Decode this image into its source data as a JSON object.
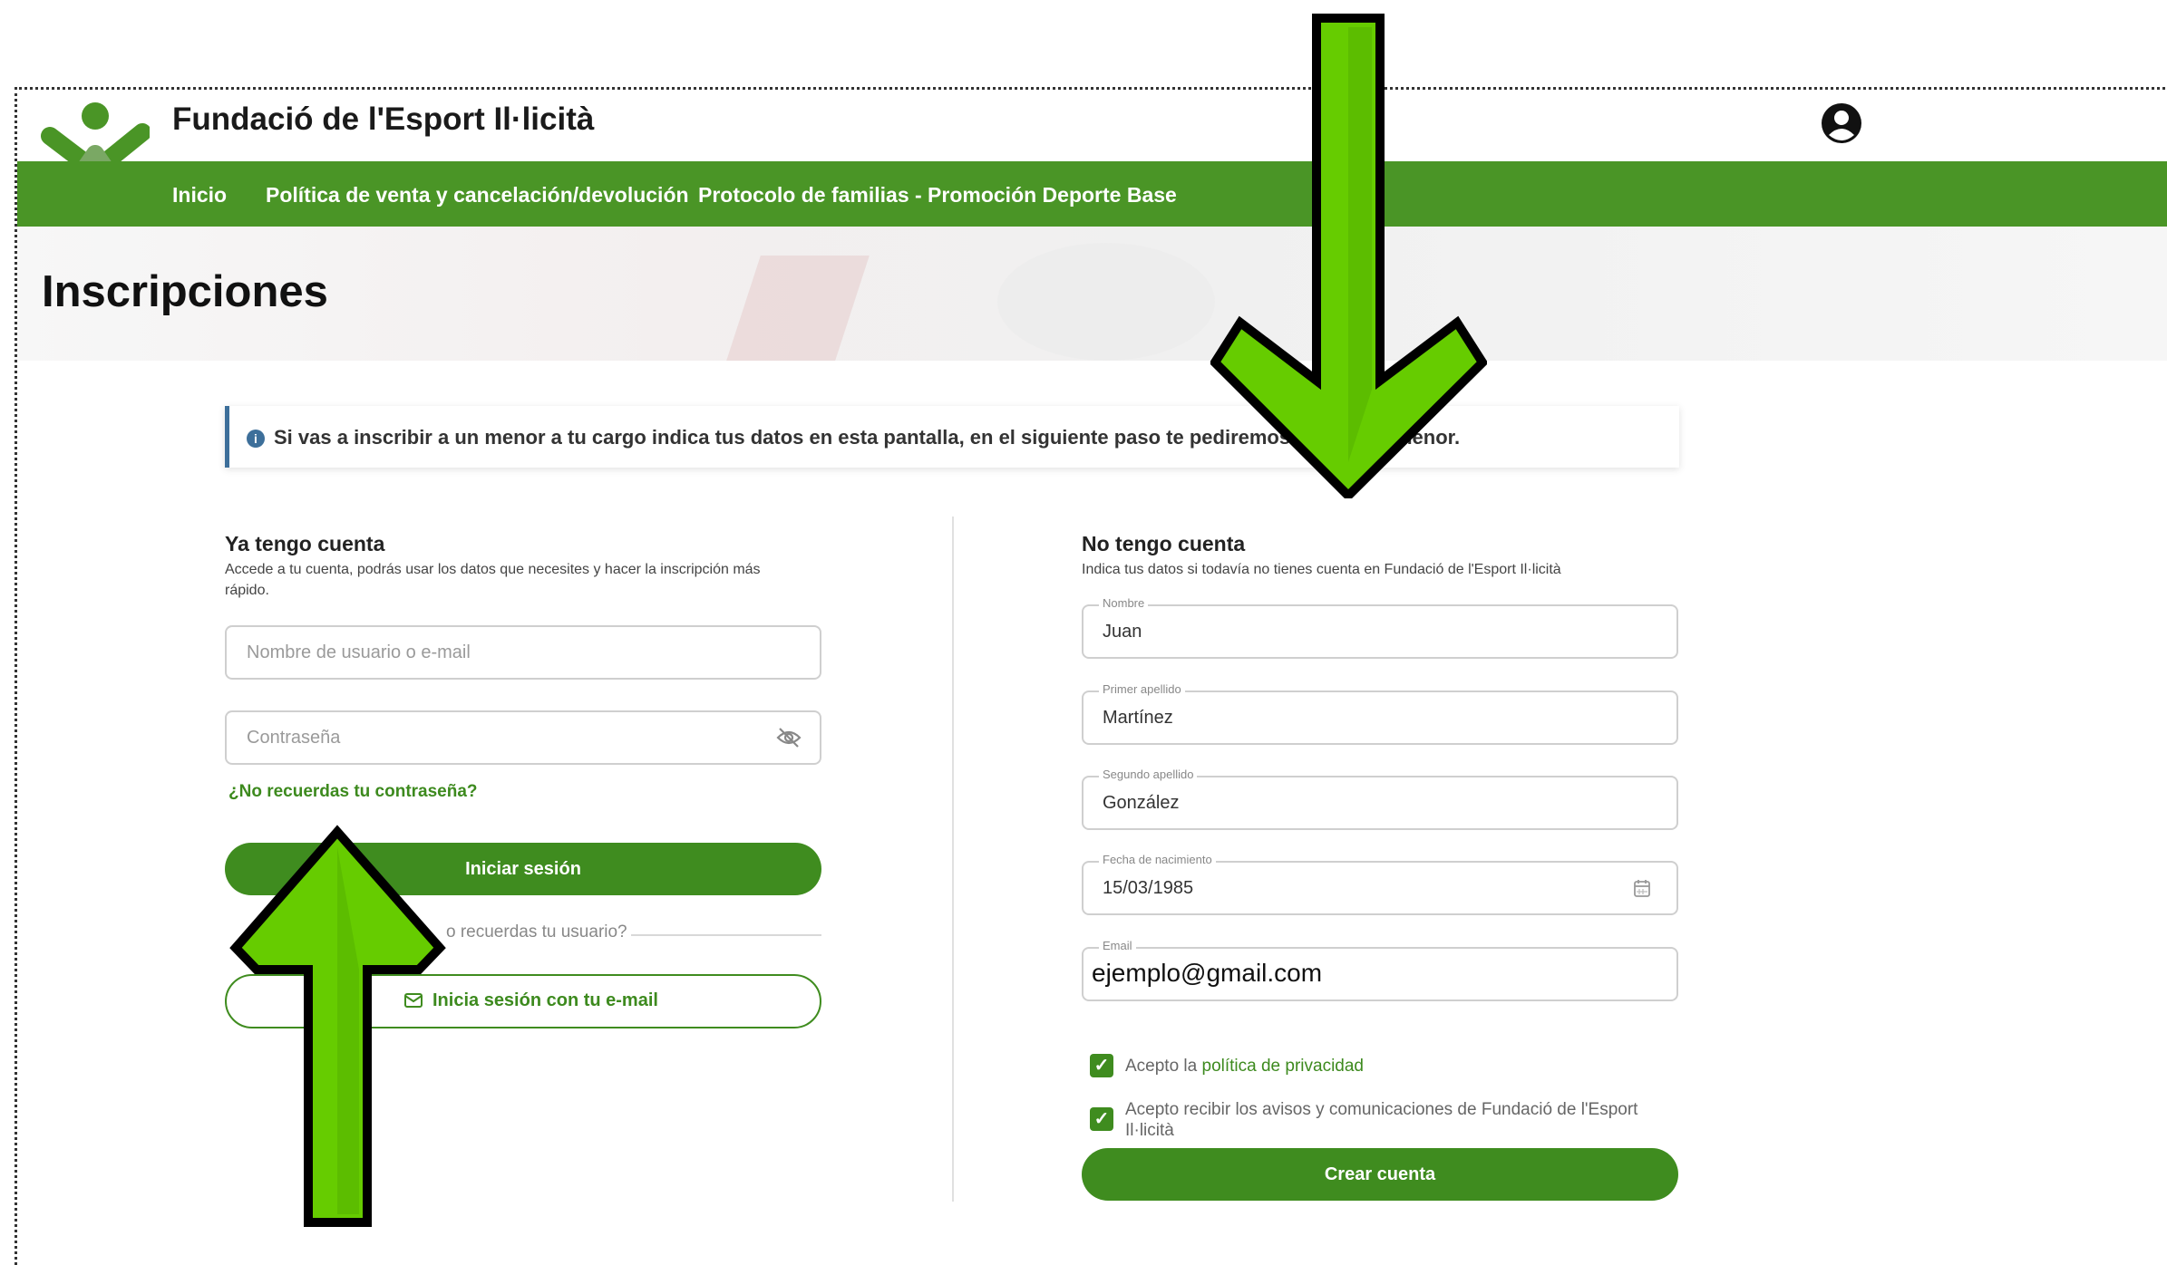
{
  "header": {
    "site_title": "Fundació de l'Esport Il·licità",
    "nav": [
      "Inicio",
      "Política de venta y cancelación/devolución",
      "Protocolo de familias - Promoción Deporte Base"
    ]
  },
  "page_title": "Inscripciones",
  "info_banner": "Si vas a inscribir a un menor a tu cargo indica tus datos en esta pantalla, en el siguiente paso te pediremos la in",
  "info_banner_tail": "menor.",
  "login": {
    "title": "Ya tengo cuenta",
    "subtitle": "Accede a tu cuenta, podrás usar los datos que necesites y hacer la inscripción más rápido.",
    "username_placeholder": "Nombre de usuario o e-mail",
    "password_placeholder": "Contraseña",
    "forgot_password": "¿No recuerdas tu contraseña?",
    "login_button": "Iniciar sesión",
    "forgot_username": "o recuerdas tu usuario?",
    "email_login_button": "Inicia sesión con tu e-mail"
  },
  "register": {
    "title": "No tengo cuenta",
    "subtitle": "Indica tus datos si todavía no tienes cuenta en Fundació de l'Esport Il·licità",
    "fields": [
      {
        "label": "Nombre",
        "value": "Juan"
      },
      {
        "label": "Primer apellido",
        "value": "Martínez"
      },
      {
        "label": "Segundo apellido",
        "value": "González"
      },
      {
        "label": "Fecha de nacimiento",
        "value": "15/03/1985"
      },
      {
        "label": "Email",
        "value": "ejemplo@gmail.com"
      }
    ],
    "privacy_prefix": "Acepto la ",
    "privacy_link": "política de privacidad",
    "communications": "Acepto recibir los avisos y comunicaciones de Fundació de l'Esport Il·licità",
    "create_button": "Crear cuenta"
  },
  "colors": {
    "brand_green": "#4a9526",
    "button_green": "#3f8c1f",
    "arrow_green": "#66cc00",
    "info_blue": "#3d6f9a"
  }
}
